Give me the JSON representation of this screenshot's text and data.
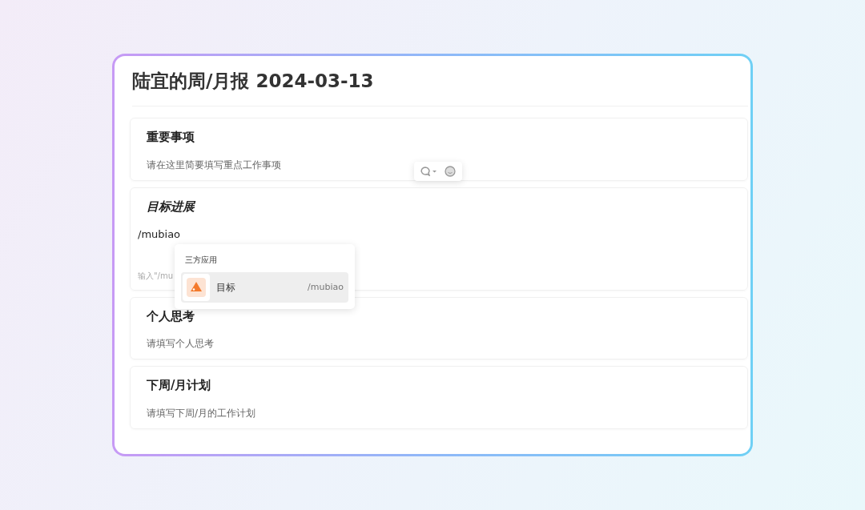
{
  "document": {
    "title": "陆宜的周/月报 2024-03-13"
  },
  "sections": [
    {
      "heading": "重要事项",
      "italic": false,
      "placeholder": "请在这里简要填写重点工作事项"
    },
    {
      "heading": "目标进展",
      "italic": true,
      "value": "/mubiao",
      "hint": "输入\"/mu"
    },
    {
      "heading": "个人思考",
      "italic": false,
      "placeholder": "请填写个人思考"
    },
    {
      "heading": "下周/月计划",
      "italic": false,
      "placeholder": "请填写下周/月的工作计划"
    }
  ],
  "floating_toolbar": {
    "items": [
      {
        "kind": "comment"
      },
      {
        "kind": "emoji"
      }
    ]
  },
  "command_menu": {
    "group": "三方应用",
    "items": [
      {
        "label": "目标",
        "command": "/mubiao",
        "selected": true
      }
    ]
  }
}
